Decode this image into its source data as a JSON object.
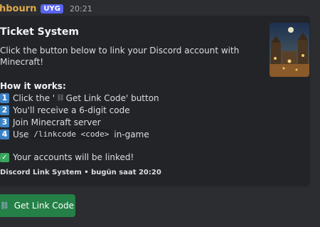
{
  "message": {
    "author": "hbourn",
    "badge": "UYG",
    "time": "20:21"
  },
  "embed": {
    "title": "Ticket System",
    "description": "Click the button below to link your Discord account with Minecraft!",
    "how_title": "How it works:",
    "steps": [
      {
        "num": "1",
        "pre": "Click the '",
        "glyph": "⛓",
        "post": " Get Link Code' button"
      },
      {
        "num": "2",
        "text": "You'll receive a 6-digit code"
      },
      {
        "num": "3",
        "text": "Join Minecraft server"
      },
      {
        "num": "4",
        "pre": "Use",
        "code": "/linkcode <code>",
        "post": "in-game"
      }
    ],
    "result_text": "Your accounts will be linked!",
    "footer": "Discord Link System • bugün saat 20:20"
  },
  "button": {
    "label": "Get Link Code",
    "icon": "link-icon"
  },
  "colors": {
    "background": "#2b2d31",
    "embed": "#232428",
    "button": "#248046",
    "badge": "#5865f2",
    "username": "#e0a94b"
  }
}
